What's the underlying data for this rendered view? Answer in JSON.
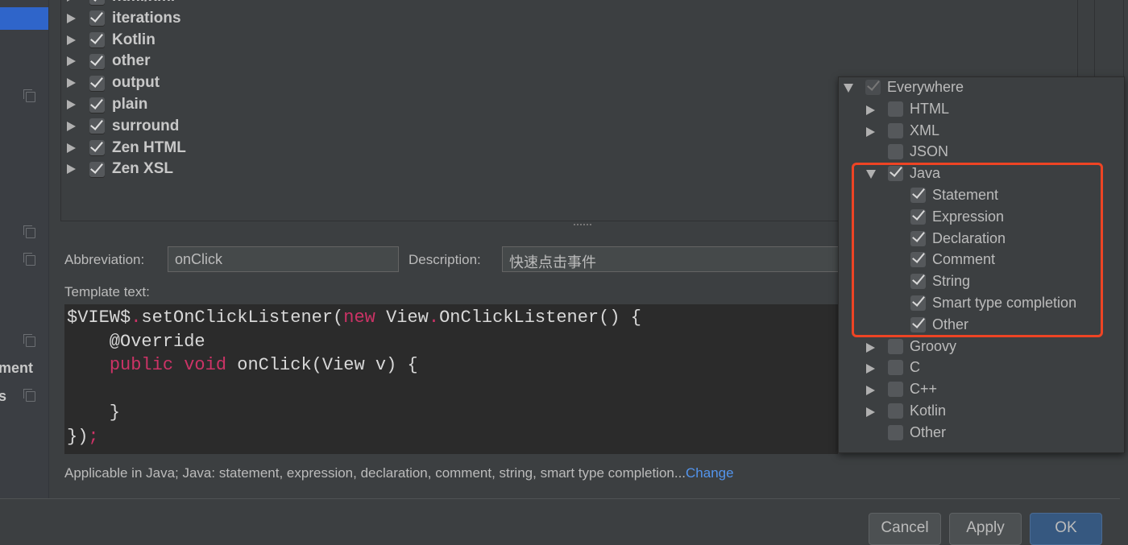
{
  "sidebar": {
    "partial_labels": [
      "ment",
      "s"
    ]
  },
  "template_groups": [
    {
      "label": "html/xml",
      "checked": true
    },
    {
      "label": "iterations",
      "checked": true
    },
    {
      "label": "Kotlin",
      "checked": true
    },
    {
      "label": "other",
      "checked": true
    },
    {
      "label": "output",
      "checked": true
    },
    {
      "label": "plain",
      "checked": true
    },
    {
      "label": "surround",
      "checked": true
    },
    {
      "label": "Zen HTML",
      "checked": true
    },
    {
      "label": "Zen XSL",
      "checked": true
    }
  ],
  "form": {
    "abbreviation_label": "Abbreviation:",
    "abbreviation_value": "onClick",
    "description_label": "Description:",
    "description_value": "快速点击事件",
    "template_text_label": "Template text:"
  },
  "code": {
    "l1a": "$VIEW$",
    "l1b": ".",
    "l1c": "setOnClickListener(",
    "l1d": "new",
    "l1e": " View",
    "l1f": ".",
    "l1g": "OnClickListener() {",
    "l2": "    @Override",
    "l3a": "    ",
    "l3b": "public void",
    "l3c": " onClick(View v) {",
    "l5": "    }",
    "l6a": "})",
    "l6b": ";"
  },
  "applicable": {
    "text": "Applicable in Java; Java: statement, expression, declaration, comment, string, smart type completion...",
    "link": "Change"
  },
  "buttons": {
    "cancel": "Cancel",
    "apply": "Apply",
    "ok": "OK"
  },
  "context_popup": {
    "root": {
      "label": "Everywhere",
      "checked": true,
      "expanded": true
    },
    "items": [
      {
        "label": "HTML",
        "checked": false,
        "expandable": true
      },
      {
        "label": "XML",
        "checked": false,
        "expandable": true
      },
      {
        "label": "JSON",
        "checked": false,
        "expandable": false
      },
      {
        "label": "Java",
        "checked": true,
        "expandable": true,
        "expanded": true,
        "children": [
          {
            "label": "Statement",
            "checked": true
          },
          {
            "label": "Expression",
            "checked": true
          },
          {
            "label": "Declaration",
            "checked": true
          },
          {
            "label": "Comment",
            "checked": true
          },
          {
            "label": "String",
            "checked": true
          },
          {
            "label": "Smart type completion",
            "checked": true
          },
          {
            "label": "Other",
            "checked": true
          }
        ]
      },
      {
        "label": "Groovy",
        "checked": false,
        "expandable": true
      },
      {
        "label": "C",
        "checked": false,
        "expandable": true
      },
      {
        "label": "C++",
        "checked": false,
        "expandable": true
      },
      {
        "label": "Kotlin",
        "checked": false,
        "expandable": true
      },
      {
        "label": "Other",
        "checked": false,
        "expandable": false
      }
    ]
  },
  "colors": {
    "highlight": "#ee4424",
    "link": "#5394ec",
    "keyword": "#cc3366",
    "selection": "#2f65ca"
  }
}
